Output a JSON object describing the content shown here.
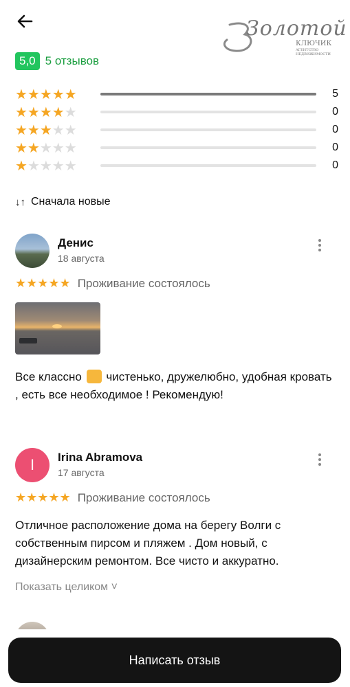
{
  "header": {
    "back_icon": "arrow-left-icon",
    "logo": {
      "main": "Золотой",
      "sub": "КЛЮЧИК",
      "tagline": "АГЕНТСТВО НЕДВИЖИМОСТИ"
    }
  },
  "summary": {
    "rating": "5,0",
    "reviews_count_label": "5 отзывов",
    "badge_color": "#22c55e",
    "distribution": [
      {
        "stars": 5,
        "count": "5",
        "fraction": 1.0
      },
      {
        "stars": 4,
        "count": "0",
        "fraction": 0
      },
      {
        "stars": 3,
        "count": "0",
        "fraction": 0
      },
      {
        "stars": 2,
        "count": "0",
        "fraction": 0
      },
      {
        "stars": 1,
        "count": "0",
        "fraction": 0
      }
    ]
  },
  "sort": {
    "icon": "sort-arrows-icon",
    "label": "Сначала новые"
  },
  "reviews": [
    {
      "name": "Денис",
      "date": "18 августа",
      "avatar": "photo",
      "stars": 5,
      "status": "Проживание состоялось",
      "has_photo": true,
      "text_before": "Все классно",
      "emoji": "thumbs-up-icon",
      "text_after": "чистенько, дружелюбно, удобная кровать , есть все необходимое ! Рекомендую!"
    },
    {
      "name": "Irina Abramova",
      "date": "17 августа",
      "avatar_letter": "I",
      "avatar_color": "#ec4f72",
      "stars": 5,
      "status": "Проживание состоялось",
      "text": "Отличное расположение дома на берегу Волги с собственным пирсом и пляжем . Дом новый, с дизайнерским ремонтом. Все чисто и аккуратно.",
      "show_more": "Показать целиком ˅"
    }
  ],
  "footer": {
    "write_button": "Написать отзыв"
  }
}
